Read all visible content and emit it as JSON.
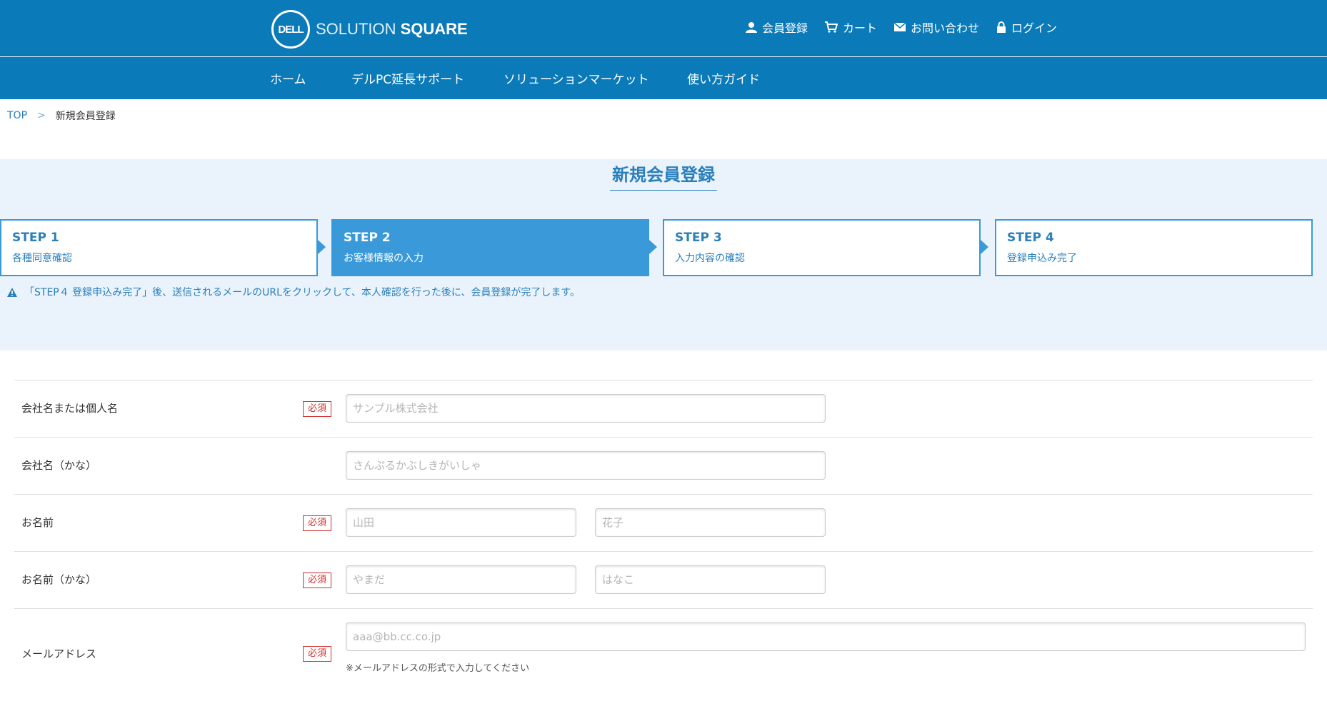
{
  "header": {
    "logo_mark": "DELL",
    "logo_light": "SOLUTION",
    "logo_bold": "SQUARE",
    "links": {
      "register": "会員登録",
      "cart": "カート",
      "contact": "お問い合わせ",
      "login": "ログイン"
    }
  },
  "nav": {
    "home": "ホーム",
    "support": "デルPC延長サポート",
    "market": "ソリューションマーケット",
    "guide": "使い方ガイド"
  },
  "breadcrumb": {
    "top": "TOP",
    "separator": ">",
    "current": "新規会員登録"
  },
  "page_title": "新規会員登録",
  "steps": [
    {
      "num": "STEP 1",
      "desc": "各種同意確認",
      "active": false
    },
    {
      "num": "STEP 2",
      "desc": "お客様情報の入力",
      "active": true
    },
    {
      "num": "STEP 3",
      "desc": "入力内容の確認",
      "active": false
    },
    {
      "num": "STEP 4",
      "desc": "登録申込み完了",
      "active": false
    }
  ],
  "notice": "「STEP４ 登録申込み完了」後、送信されるメールのURLをクリックして、本人確認を行った後に、会員登録が完了します。",
  "form": {
    "required_label": "必須",
    "company": {
      "label": "会社名または個人名",
      "placeholder": "サンプル株式会社"
    },
    "company_kana": {
      "label": "会社名（かな）",
      "placeholder": "さんぷるかぶしきがいしゃ"
    },
    "name": {
      "label": "お名前",
      "last_placeholder": "山田",
      "first_placeholder": "花子"
    },
    "name_kana": {
      "label": "お名前（かな）",
      "last_placeholder": "やまだ",
      "first_placeholder": "はなこ"
    },
    "email": {
      "label": "メールアドレス",
      "placeholder": "aaa@bb.cc.co.jp",
      "hint": "※メールアドレスの形式で入力してください"
    }
  },
  "colors": {
    "header_bg": "#0b7ab8",
    "accent": "#3a9ad9",
    "hero_bg": "#eaf3fb",
    "required": "#d32f2f"
  }
}
